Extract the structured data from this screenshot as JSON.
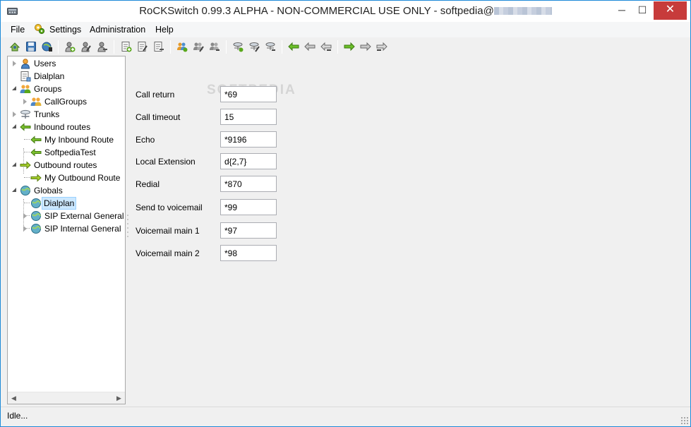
{
  "window": {
    "title_prefix": "RoCKSwitch 0.99.3 ALPHA - NON-COMMERCIAL USE ONLY - softpedia@",
    "minimize_glyph": "─",
    "maximize_glyph": "☐",
    "close_glyph": "✕"
  },
  "menu": {
    "file": "File",
    "settings": "Settings",
    "administration": "Administration",
    "help": "Help"
  },
  "toolbar": {
    "icons": [
      "connect-icon",
      "save-icon",
      "globe-network-icon",
      "add-user-icon",
      "edit-user-icon",
      "remove-user-icon",
      "add-dialplan-icon",
      "edit-dialplan-icon",
      "remove-dialplan-icon",
      "add-group-icon",
      "edit-group-icon",
      "remove-group-icon",
      "add-trunk-icon",
      "edit-trunk-icon",
      "remove-trunk-icon",
      "add-inbound-route-icon",
      "edit-inbound-route-icon",
      "remove-inbound-route-icon",
      "add-outbound-route-icon",
      "edit-outbound-route-icon",
      "remove-outbound-route-icon"
    ]
  },
  "tree": {
    "users": "Users",
    "dialplan": "Dialplan",
    "groups": "Groups",
    "callgroups": "CallGroups",
    "trunks": "Trunks",
    "inbound_routes": "Inbound routes",
    "my_inbound_route": "My Inbound Route",
    "softpedia_test": "SoftpediaTest",
    "outbound_routes": "Outbound routes",
    "my_outbound_route": "My Outbound Route",
    "globals": "Globals",
    "globals_dialplan": "Dialplan",
    "sip_external_general": "SIP External General",
    "sip_internal_general": "SIP Internal General"
  },
  "form": {
    "watermark": "SOFTPEDIA",
    "fields": [
      {
        "label": "Call return",
        "value": "*69"
      },
      {
        "label": "Call timeout",
        "value": "15"
      },
      {
        "label": "Echo",
        "value": "*9196"
      },
      {
        "label": "Local Extension",
        "value": "d{2,7}"
      },
      {
        "label": "Redial",
        "value": "*870"
      },
      {
        "label": "Send to voicemail",
        "value": "*99"
      },
      {
        "label": "Voicemail main 1",
        "value": "*97"
      },
      {
        "label": "Voicemail main 2",
        "value": "*98"
      }
    ]
  },
  "status": {
    "text": "Idle..."
  },
  "colors": {
    "accent_green": "#5aa81c",
    "selection": "#cce8ff",
    "close_button": "#c73b3b"
  }
}
